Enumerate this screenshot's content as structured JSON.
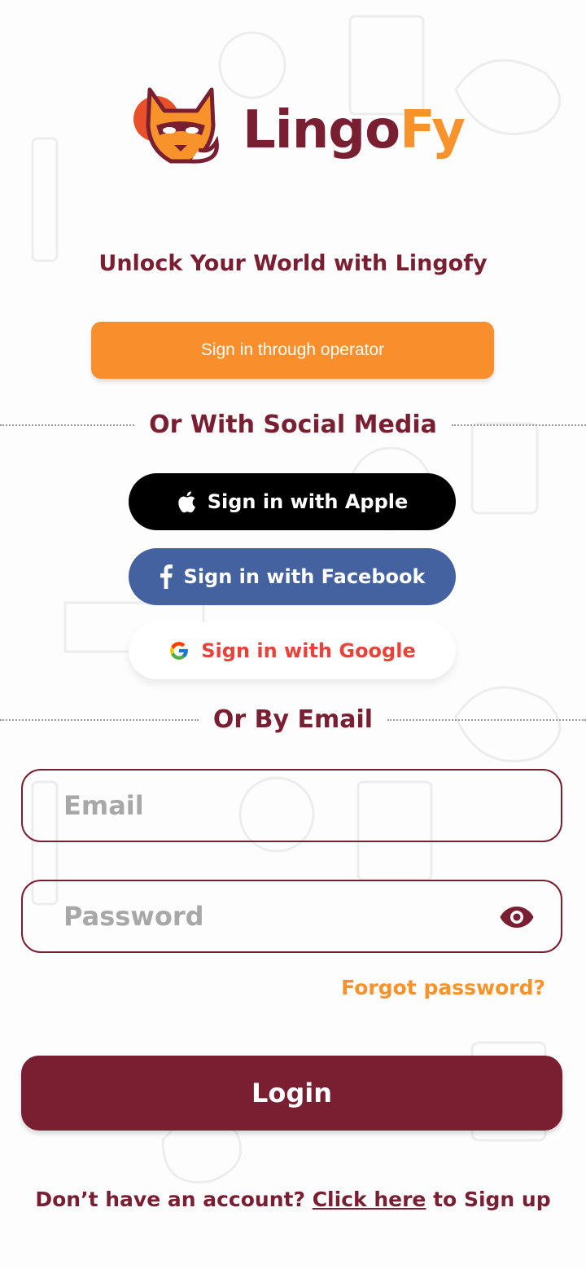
{
  "brand": {
    "part1": "Lingo",
    "part2": "Fy",
    "primary_color": "#7a1e32",
    "accent_color": "#f8932c"
  },
  "tagline": "Unlock Your World with Lingofy",
  "operator_button": {
    "label": "Sign in through operator"
  },
  "social_divider": "Or With Social Media",
  "social": {
    "apple": {
      "label": "Sign in with Apple",
      "icon": "apple-icon"
    },
    "facebook": {
      "label": "Sign in with Facebook",
      "icon": "facebook-icon"
    },
    "google": {
      "label": "Sign in with Google",
      "icon": "google-icon"
    }
  },
  "email_divider": "Or By Email",
  "form": {
    "email_placeholder": "Email",
    "password_placeholder": "Password",
    "password_toggle_icon": "eye-icon",
    "forgot": "Forgot password?",
    "login": "Login"
  },
  "signup": {
    "prefix": "Don’t have an account?",
    "link": "Click here",
    "suffix": "to Sign up"
  }
}
